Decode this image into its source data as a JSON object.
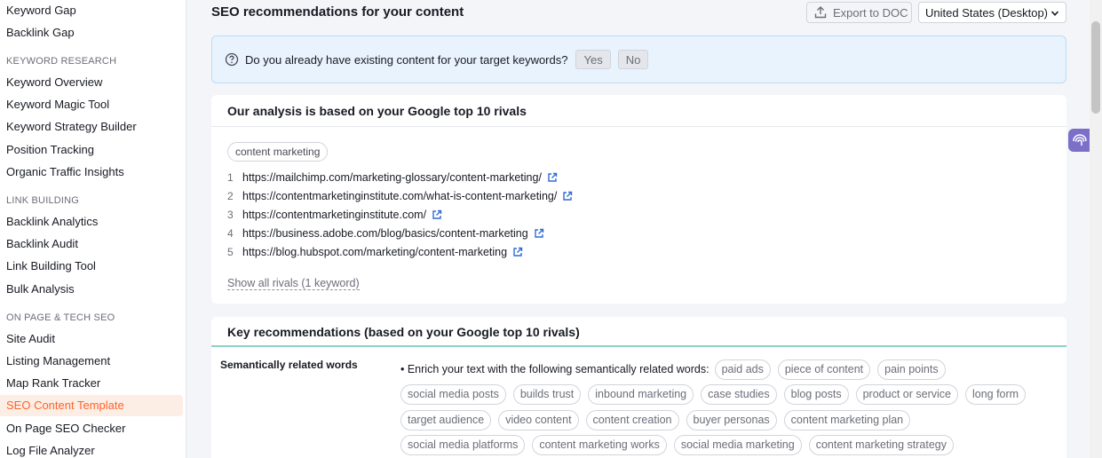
{
  "sidebar": {
    "items_top": [
      {
        "label": "Keyword Gap"
      },
      {
        "label": "Backlink Gap"
      }
    ],
    "keyword_research": {
      "heading": "KEYWORD RESEARCH",
      "items": [
        {
          "label": "Keyword Overview"
        },
        {
          "label": "Keyword Magic Tool"
        },
        {
          "label": "Keyword Strategy Builder"
        },
        {
          "label": "Position Tracking"
        },
        {
          "label": "Organic Traffic Insights"
        }
      ]
    },
    "link_building": {
      "heading": "LINK BUILDING",
      "items": [
        {
          "label": "Backlink Analytics"
        },
        {
          "label": "Backlink Audit"
        },
        {
          "label": "Link Building Tool"
        },
        {
          "label": "Bulk Analysis"
        }
      ]
    },
    "on_page": {
      "heading": "ON PAGE & TECH SEO",
      "items": [
        {
          "label": "Site Audit"
        },
        {
          "label": "Listing Management"
        },
        {
          "label": "Map Rank Tracker"
        },
        {
          "label": "SEO Content Template",
          "active": true
        },
        {
          "label": "On Page SEO Checker"
        },
        {
          "label": "Log File Analyzer"
        }
      ]
    }
  },
  "header": {
    "title": "SEO recommendations for your content",
    "export_label": "Export to DOC",
    "country_value": "United States (Desktop)"
  },
  "question": {
    "text": "Do you already have existing content for your target keywords?",
    "yes_label": "Yes",
    "no_label": "No"
  },
  "rivals": {
    "title": "Our analysis is based on your Google top 10 rivals",
    "keyword_chip": "content marketing",
    "list": [
      {
        "num": "1",
        "url": "https://mailchimp.com/marketing-glossary/content-marketing/"
      },
      {
        "num": "2",
        "url": "https://contentmarketinginstitute.com/what-is-content-marketing/"
      },
      {
        "num": "3",
        "url": "https://contentmarketinginstitute.com/"
      },
      {
        "num": "4",
        "url": "https://business.adobe.com/blog/basics/content-marketing"
      },
      {
        "num": "5",
        "url": "https://blog.hubspot.com/marketing/content-marketing"
      }
    ],
    "show_all_label": "Show all rivals (1 keyword)"
  },
  "recommendations": {
    "title": "Key recommendations (based on your Google top 10 rivals)",
    "semantic": {
      "label": "Semantically related words",
      "intro": "• Enrich your text with the following semantically related words:",
      "tags_rows": [
        [
          "paid ads",
          "piece of content",
          "pain points"
        ],
        [
          "social media posts",
          "builds trust",
          "inbound marketing",
          "case studies",
          "blog posts",
          "product or service",
          "long form"
        ],
        [
          "target audience",
          "video content",
          "content creation",
          "buyer personas",
          "content marketing plan"
        ],
        [
          "social media platforms",
          "content marketing works",
          "social media marketing",
          "content marketing strategy"
        ]
      ]
    }
  },
  "colors": {
    "accent": "#ff642d",
    "active_bg": "#fdeee5",
    "info_bg": "#e9f3fd",
    "link_icon": "#2f6bd2",
    "reco_divider": "#8fd1c7"
  },
  "icons": {
    "export": "upload-icon",
    "chevron": "chevron-down-icon",
    "question": "question-circle-icon",
    "external": "external-link-icon",
    "widget": "brain-icon"
  }
}
